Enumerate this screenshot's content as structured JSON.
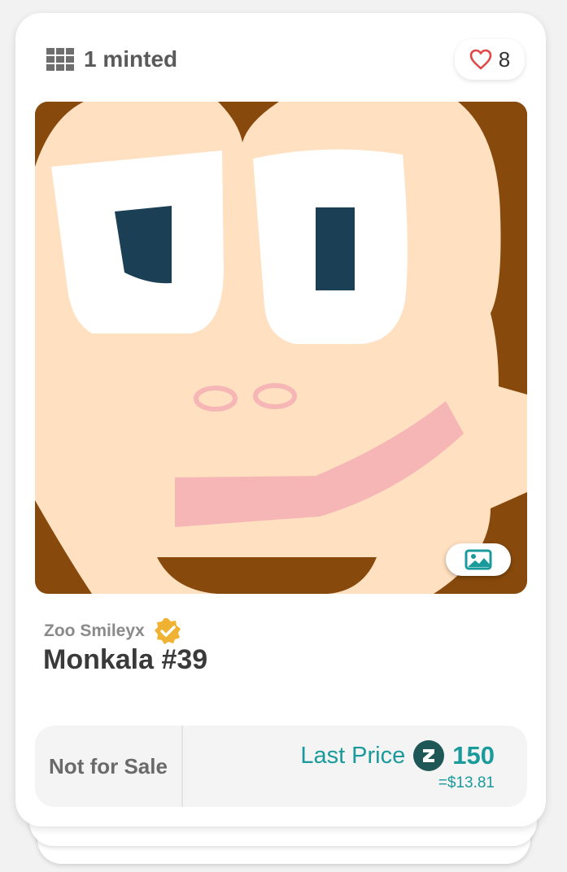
{
  "card": {
    "minted_text": "1 minted",
    "likes_count": "8",
    "collection_name": "Zoo Smileyx",
    "nft_title": "Monkala #39",
    "sale_status": "Not for Sale",
    "last_price_label": "Last Price",
    "last_price_value": "150",
    "last_price_usd": "=$13.81",
    "icons": {
      "minted": "grid-icon",
      "likes": "heart-icon",
      "media": "image-icon",
      "verified": "verified-badge-icon",
      "currency": "coin-icon"
    },
    "colors": {
      "accent": "#1a9a9a",
      "heart": "#e04848",
      "verified": "#f0b232",
      "art_background": "#884a0c",
      "art_face": "#ffe0c0",
      "art_eyes": "#1b3f55",
      "art_mouth": "#f7b6b6"
    }
  }
}
